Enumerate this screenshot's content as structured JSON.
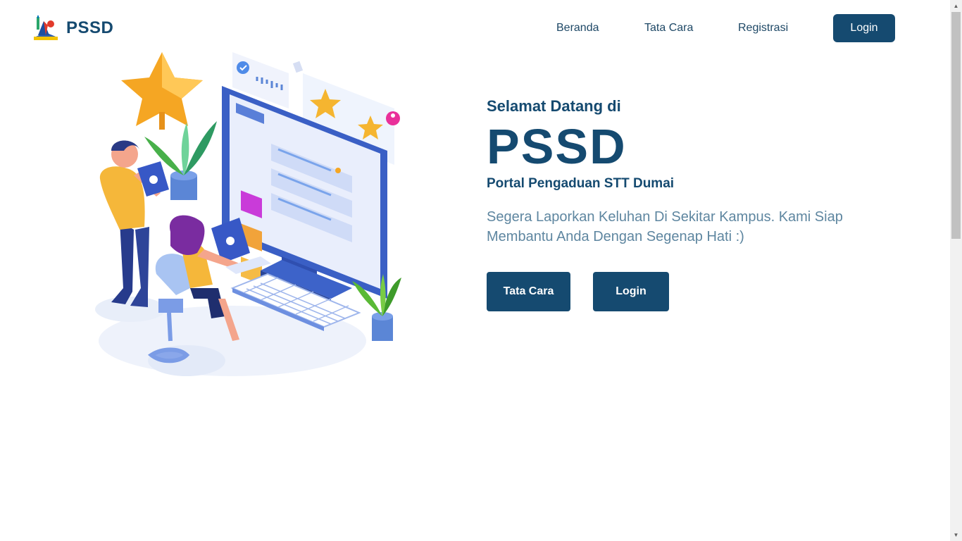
{
  "brand": {
    "name": "PSSD",
    "logo_icon": "pssd-logo-icon"
  },
  "nav": {
    "items": [
      {
        "label": "Beranda"
      },
      {
        "label": "Tata Cara"
      },
      {
        "label": "Registrasi"
      }
    ],
    "login_label": "Login"
  },
  "hero": {
    "greeting": "Selamat Datang di",
    "title": "PSSD",
    "subtitle": "Portal Pengaduan STT Dumai",
    "description": "Segera Laporkan Keluhan Di Sekitar Kampus. Kami Siap Membantu Anda Dengan Segenap Hati :)",
    "buttons": [
      {
        "label": "Tata Cara"
      },
      {
        "label": "Login"
      }
    ]
  },
  "colors": {
    "primary": "#154a70",
    "text_muted": "#5e86a0",
    "background": "#ffffff"
  }
}
